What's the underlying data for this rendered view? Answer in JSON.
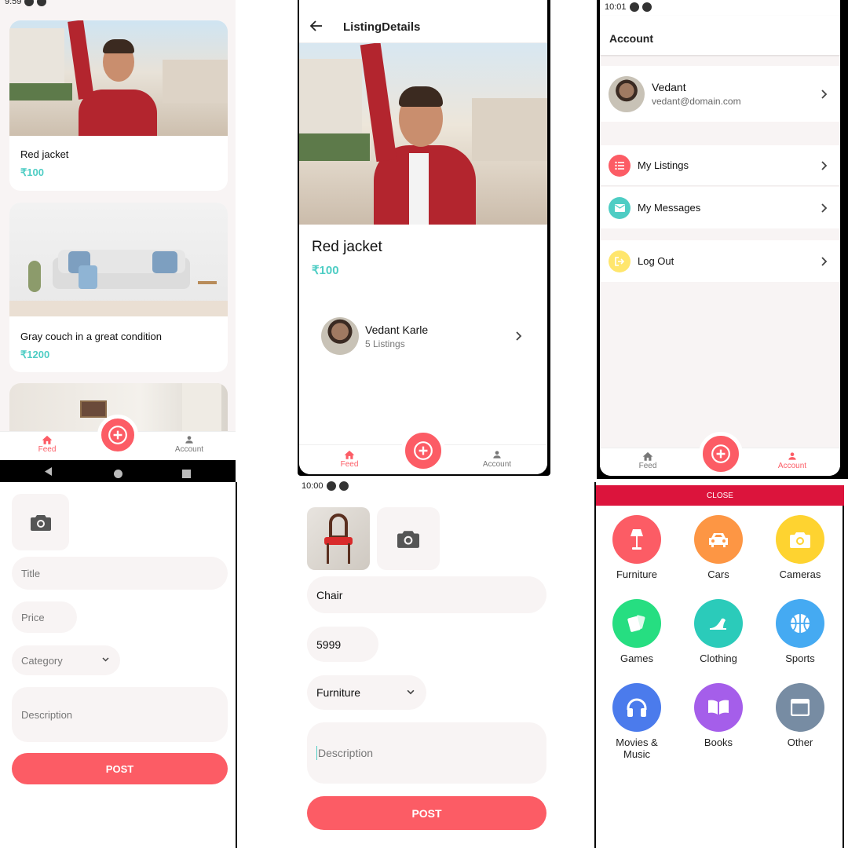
{
  "feed": {
    "status_time": "9:59",
    "cards": [
      {
        "title": "Red jacket",
        "price": "₹100"
      },
      {
        "title": "Gray couch in a great condition",
        "price": "₹1200"
      }
    ],
    "tabs": {
      "feed": "Feed",
      "account": "Account"
    }
  },
  "details": {
    "header_title": "ListingDetails",
    "title": "Red jacket",
    "price": "₹100",
    "seller_name": "Vedant Karle",
    "seller_listings": "5 Listings",
    "tabs": {
      "feed": "Feed",
      "account": "Account"
    }
  },
  "account": {
    "status_time": "10:01",
    "header_title": "Account",
    "user_name": "Vedant",
    "user_email": "vedant@domain.com",
    "menu": [
      {
        "label": "My Listings",
        "icon": "format-list-bulleted-icon",
        "color": "#fc5c65"
      },
      {
        "label": "My Messages",
        "icon": "email-icon",
        "color": "#4ecdc4"
      }
    ],
    "logout_label": "Log Out",
    "logout_color": "#ffe66d",
    "tabs": {
      "feed": "Feed",
      "account": "Account"
    }
  },
  "form_empty": {
    "title_placeholder": "Title",
    "price_placeholder": "Price",
    "category_placeholder": "Category",
    "description_placeholder": "Description",
    "post_label": "POST"
  },
  "form_filled": {
    "status_time": "10:00",
    "title_value": "Chair",
    "price_value": "5999",
    "category_value": "Furniture",
    "description_placeholder": "Description",
    "post_label": "POST"
  },
  "categories": {
    "close_label": "CLOSE",
    "items": [
      {
        "label": "Furniture",
        "icon": "floor-lamp-icon",
        "color": "#fc5c65"
      },
      {
        "label": "Cars",
        "icon": "car-icon",
        "color": "#fd9644"
      },
      {
        "label": "Cameras",
        "icon": "camera-icon",
        "color": "#fed330"
      },
      {
        "label": "Games",
        "icon": "cards-icon",
        "color": "#26de81"
      },
      {
        "label": "Clothing",
        "icon": "shoe-heel-icon",
        "color": "#2bcbba"
      },
      {
        "label": "Sports",
        "icon": "basketball-icon",
        "color": "#45aaf2"
      },
      {
        "label": "Movies & Music",
        "icon": "headphones-icon",
        "color": "#4b7bec"
      },
      {
        "label": "Books",
        "icon": "book-open-icon",
        "color": "#a55eea"
      },
      {
        "label": "Other",
        "icon": "application-icon",
        "color": "#778ca3"
      }
    ],
    "accent": "#dc143c"
  },
  "colors": {
    "primary": "#fc5c65",
    "secondary": "#4ecdc4",
    "light": "#f8f4f4"
  }
}
